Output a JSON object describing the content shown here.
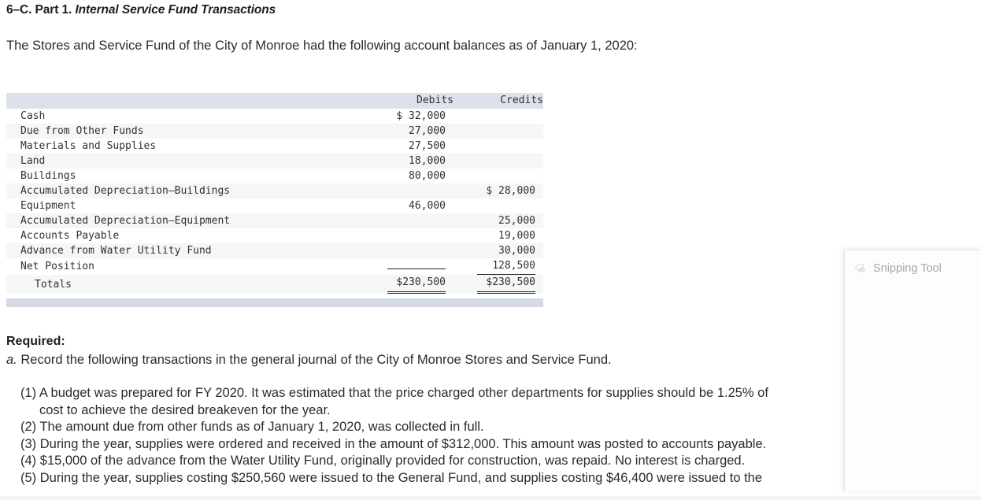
{
  "heading": {
    "prefix": "6–C. Part 1.",
    "title": "Internal Service Fund Transactions"
  },
  "intro": "The Stores and Service Fund of the City of Monroe had the following account balances as of January 1, 2020:",
  "table": {
    "columns": [
      "",
      "Debits",
      "Credits"
    ],
    "rows": [
      {
        "account": "Cash",
        "debit": "$ 32,000",
        "credit": ""
      },
      {
        "account": "Due from Other Funds",
        "debit": "27,000",
        "credit": ""
      },
      {
        "account": "Materials and Supplies",
        "debit": "27,500",
        "credit": ""
      },
      {
        "account": "Land",
        "debit": "18,000",
        "credit": ""
      },
      {
        "account": "Buildings",
        "debit": "80,000",
        "credit": ""
      },
      {
        "account": "Accumulated Depreciation–Buildings",
        "debit": "",
        "credit": "$ 28,000"
      },
      {
        "account": "Equipment",
        "debit": "46,000",
        "credit": ""
      },
      {
        "account": "Accumulated Depreciation–Equipment",
        "debit": "",
        "credit": "25,000"
      },
      {
        "account": "Accounts Payable",
        "debit": "",
        "credit": "19,000"
      },
      {
        "account": "Advance from Water Utility Fund",
        "debit": "",
        "credit": "30,000"
      },
      {
        "account": "Net Position",
        "debit": "",
        "credit": "128,500"
      }
    ],
    "totals": {
      "label": "Totals",
      "debit": "$230,500",
      "credit": "$230,500"
    }
  },
  "required": {
    "label": "Required:",
    "item_a_marker": "a.",
    "item_a_text": "Record the following transactions in the general journal of the City of Monroe Stores and Service Fund.",
    "transactions": [
      {
        "marker": "(1)",
        "line1": "A budget was prepared for FY 2020. It was estimated that the price charged other departments for supplies should be 1.25% of",
        "line2": "cost to achieve the desired breakeven for the year."
      },
      {
        "marker": "(2)",
        "line1": "The amount due from other funds as of January 1, 2020, was collected in full.",
        "line2": ""
      },
      {
        "marker": "(3)",
        "line1": "During the year, supplies were ordered and received in the amount of $312,000. This amount was posted to accounts payable.",
        "line2": ""
      },
      {
        "marker": "(4)",
        "line1": "$15,000 of the advance from the Water Utility Fund, originally provided for construction, was repaid. No interest is charged.",
        "line2": ""
      },
      {
        "marker": "(5)",
        "line1": "During the year, supplies costing $250,560 were issued to the General Fund, and supplies costing $46,400 were issued to the",
        "line2": ""
      }
    ]
  },
  "snipping_tool": {
    "title": "Snipping Tool",
    "icon": "scissors-icon"
  },
  "colors": {
    "table_header_bg": "#dce1ea",
    "table_footer_bg": "#d4dae6",
    "row_stripe_bg": "#f5f6f7",
    "text": "#2b2b2b"
  }
}
